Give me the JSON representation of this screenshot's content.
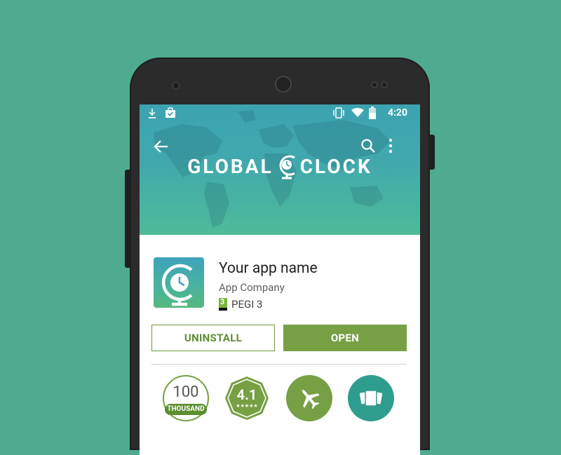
{
  "status_bar": {
    "time": "4:20"
  },
  "hero": {
    "brand_left": "GLOBAL",
    "brand_right": "CLOCK"
  },
  "app": {
    "name": "Your app name",
    "company": "App Company",
    "rating_badge": "3",
    "rating_label": "PEGI 3"
  },
  "actions": {
    "uninstall_label": "UNINSTALL",
    "open_label": "OPEN"
  },
  "badges": {
    "downloads_value": "100",
    "downloads_unit": "THOUSAND",
    "rating_value": "4.1",
    "category_icon": "airplane-icon",
    "similar_icon": "cards-icon"
  },
  "colors": {
    "background": "#4fab8f",
    "accent_green": "#76a043",
    "teal": "#2f9d8e",
    "hero_top": "#3ca3b0",
    "hero_bottom": "#4fbb98"
  }
}
